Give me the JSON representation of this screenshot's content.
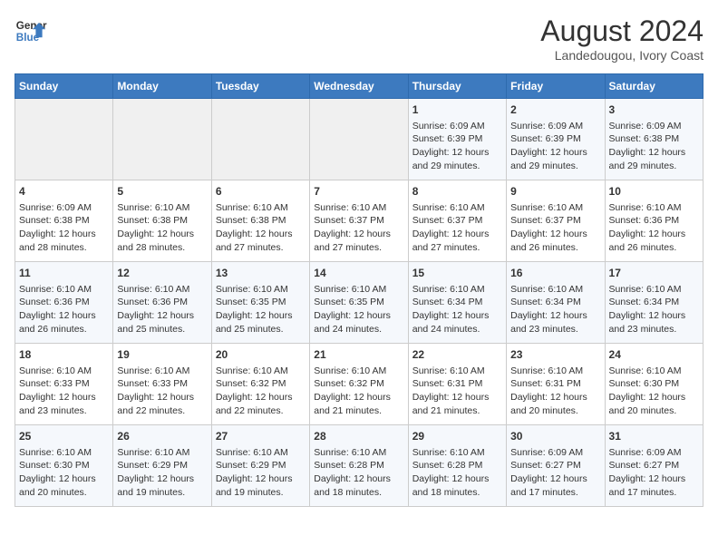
{
  "header": {
    "logo_line1": "General",
    "logo_line2": "Blue",
    "month_year": "August 2024",
    "location": "Landedougou, Ivory Coast"
  },
  "weekdays": [
    "Sunday",
    "Monday",
    "Tuesday",
    "Wednesday",
    "Thursday",
    "Friday",
    "Saturday"
  ],
  "weeks": [
    [
      {
        "day": "",
        "info": ""
      },
      {
        "day": "",
        "info": ""
      },
      {
        "day": "",
        "info": ""
      },
      {
        "day": "",
        "info": ""
      },
      {
        "day": "1",
        "info": "Sunrise: 6:09 AM\nSunset: 6:39 PM\nDaylight: 12 hours\nand 29 minutes."
      },
      {
        "day": "2",
        "info": "Sunrise: 6:09 AM\nSunset: 6:39 PM\nDaylight: 12 hours\nand 29 minutes."
      },
      {
        "day": "3",
        "info": "Sunrise: 6:09 AM\nSunset: 6:38 PM\nDaylight: 12 hours\nand 29 minutes."
      }
    ],
    [
      {
        "day": "4",
        "info": "Sunrise: 6:09 AM\nSunset: 6:38 PM\nDaylight: 12 hours\nand 28 minutes."
      },
      {
        "day": "5",
        "info": "Sunrise: 6:10 AM\nSunset: 6:38 PM\nDaylight: 12 hours\nand 28 minutes."
      },
      {
        "day": "6",
        "info": "Sunrise: 6:10 AM\nSunset: 6:38 PM\nDaylight: 12 hours\nand 27 minutes."
      },
      {
        "day": "7",
        "info": "Sunrise: 6:10 AM\nSunset: 6:37 PM\nDaylight: 12 hours\nand 27 minutes."
      },
      {
        "day": "8",
        "info": "Sunrise: 6:10 AM\nSunset: 6:37 PM\nDaylight: 12 hours\nand 27 minutes."
      },
      {
        "day": "9",
        "info": "Sunrise: 6:10 AM\nSunset: 6:37 PM\nDaylight: 12 hours\nand 26 minutes."
      },
      {
        "day": "10",
        "info": "Sunrise: 6:10 AM\nSunset: 6:36 PM\nDaylight: 12 hours\nand 26 minutes."
      }
    ],
    [
      {
        "day": "11",
        "info": "Sunrise: 6:10 AM\nSunset: 6:36 PM\nDaylight: 12 hours\nand 26 minutes."
      },
      {
        "day": "12",
        "info": "Sunrise: 6:10 AM\nSunset: 6:36 PM\nDaylight: 12 hours\nand 25 minutes."
      },
      {
        "day": "13",
        "info": "Sunrise: 6:10 AM\nSunset: 6:35 PM\nDaylight: 12 hours\nand 25 minutes."
      },
      {
        "day": "14",
        "info": "Sunrise: 6:10 AM\nSunset: 6:35 PM\nDaylight: 12 hours\nand 24 minutes."
      },
      {
        "day": "15",
        "info": "Sunrise: 6:10 AM\nSunset: 6:34 PM\nDaylight: 12 hours\nand 24 minutes."
      },
      {
        "day": "16",
        "info": "Sunrise: 6:10 AM\nSunset: 6:34 PM\nDaylight: 12 hours\nand 23 minutes."
      },
      {
        "day": "17",
        "info": "Sunrise: 6:10 AM\nSunset: 6:34 PM\nDaylight: 12 hours\nand 23 minutes."
      }
    ],
    [
      {
        "day": "18",
        "info": "Sunrise: 6:10 AM\nSunset: 6:33 PM\nDaylight: 12 hours\nand 23 minutes."
      },
      {
        "day": "19",
        "info": "Sunrise: 6:10 AM\nSunset: 6:33 PM\nDaylight: 12 hours\nand 22 minutes."
      },
      {
        "day": "20",
        "info": "Sunrise: 6:10 AM\nSunset: 6:32 PM\nDaylight: 12 hours\nand 22 minutes."
      },
      {
        "day": "21",
        "info": "Sunrise: 6:10 AM\nSunset: 6:32 PM\nDaylight: 12 hours\nand 21 minutes."
      },
      {
        "day": "22",
        "info": "Sunrise: 6:10 AM\nSunset: 6:31 PM\nDaylight: 12 hours\nand 21 minutes."
      },
      {
        "day": "23",
        "info": "Sunrise: 6:10 AM\nSunset: 6:31 PM\nDaylight: 12 hours\nand 20 minutes."
      },
      {
        "day": "24",
        "info": "Sunrise: 6:10 AM\nSunset: 6:30 PM\nDaylight: 12 hours\nand 20 minutes."
      }
    ],
    [
      {
        "day": "25",
        "info": "Sunrise: 6:10 AM\nSunset: 6:30 PM\nDaylight: 12 hours\nand 20 minutes."
      },
      {
        "day": "26",
        "info": "Sunrise: 6:10 AM\nSunset: 6:29 PM\nDaylight: 12 hours\nand 19 minutes."
      },
      {
        "day": "27",
        "info": "Sunrise: 6:10 AM\nSunset: 6:29 PM\nDaylight: 12 hours\nand 19 minutes."
      },
      {
        "day": "28",
        "info": "Sunrise: 6:10 AM\nSunset: 6:28 PM\nDaylight: 12 hours\nand 18 minutes."
      },
      {
        "day": "29",
        "info": "Sunrise: 6:10 AM\nSunset: 6:28 PM\nDaylight: 12 hours\nand 18 minutes."
      },
      {
        "day": "30",
        "info": "Sunrise: 6:09 AM\nSunset: 6:27 PM\nDaylight: 12 hours\nand 17 minutes."
      },
      {
        "day": "31",
        "info": "Sunrise: 6:09 AM\nSunset: 6:27 PM\nDaylight: 12 hours\nand 17 minutes."
      }
    ]
  ]
}
